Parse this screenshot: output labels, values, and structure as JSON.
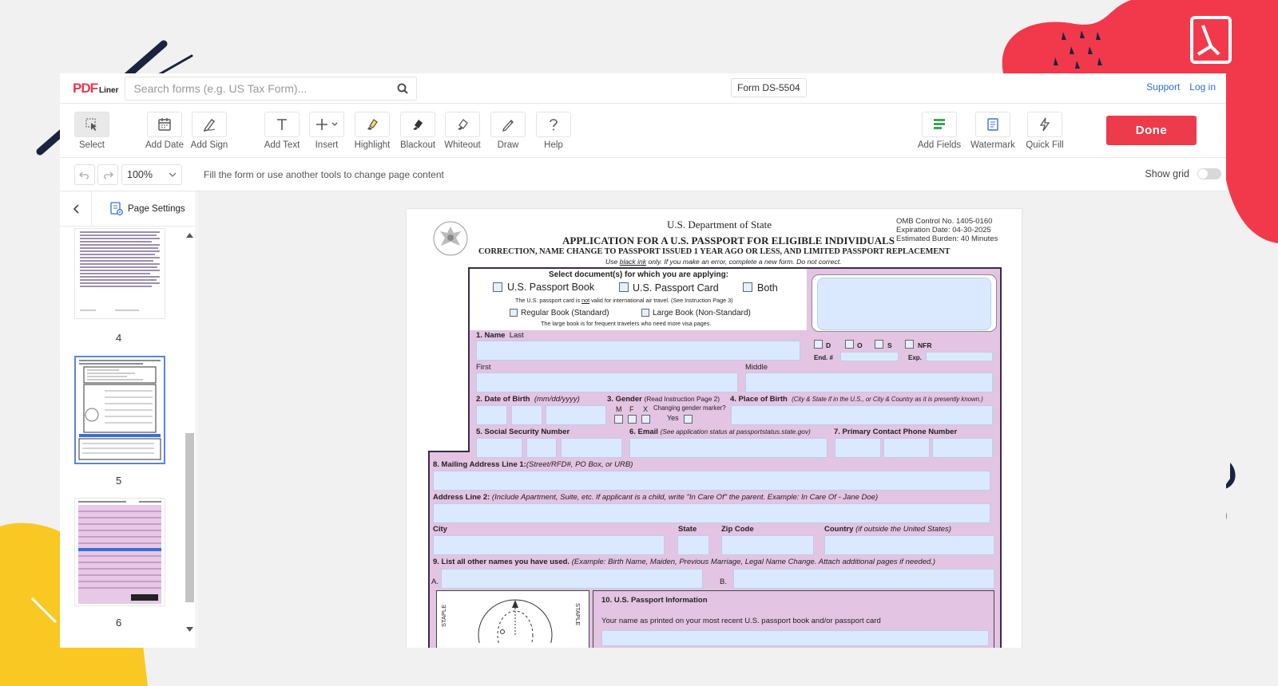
{
  "colors": {
    "accent": "#ed3b4b",
    "link": "#2a6fd6",
    "field": "#dbe9ff",
    "form_bg": "#e3c4e3"
  },
  "logo": {
    "main": "PDF",
    "sub": "Liner"
  },
  "search": {
    "placeholder": "Search forms (e.g. US Tax Form)...",
    "icon": "search-icon"
  },
  "form_name": "Form DS-5504",
  "links": {
    "support": "Support",
    "login": "Log in"
  },
  "toolbar": {
    "left": [
      {
        "label": "Select",
        "icon": "cursor-icon"
      },
      {
        "label": "Add Date",
        "icon": "calendar-icon"
      },
      {
        "label": "Add Sign",
        "icon": "signature-icon"
      },
      {
        "label": "Add Text",
        "icon": "text-icon"
      },
      {
        "label": "Insert",
        "icon": "plus-icon"
      },
      {
        "label": "Highlight",
        "icon": "highlighter-icon"
      },
      {
        "label": "Blackout",
        "icon": "blackout-icon"
      },
      {
        "label": "Whiteout",
        "icon": "eraser-icon"
      },
      {
        "label": "Draw",
        "icon": "pen-icon"
      },
      {
        "label": "Help",
        "icon": "help-icon"
      }
    ],
    "right": [
      {
        "label": "Add Fields",
        "icon": "fields-icon"
      },
      {
        "label": "Watermark",
        "icon": "watermark-icon"
      },
      {
        "label": "Quick Fill",
        "icon": "lightning-icon"
      }
    ],
    "done": "Done"
  },
  "subbar": {
    "zoom": "100%",
    "hint": "Fill the form or use another tools to change page content",
    "grid_label": "Show grid",
    "grid_on": false
  },
  "sidebar": {
    "page_settings": "Page Settings",
    "pages": [
      "4",
      "5",
      "6"
    ],
    "selected_page": "5"
  },
  "form": {
    "dept": "U.S. Department of State",
    "title": "APPLICATION FOR A U.S. PASSPORT FOR ELIGIBLE INDIVIDUALS",
    "subtitle": "CORRECTION, NAME CHANGE TO PASSPORT ISSUED 1 YEAR AGO OR LESS, AND LIMITED PASSPORT REPLACEMENT",
    "ink_note_pre": "Use ",
    "ink_note_u": "black ink",
    "ink_note_post": " only. If you make an error, complete a new form. Do not correct.",
    "omb": "OMB Control No. 1405-0160",
    "expiration": "Expiration Date: 04-30-2025",
    "burden": "Estimated Burden: 40 Minutes",
    "select_docs": "Select document(s) for which you are applying:",
    "book": "U.S. Passport Book",
    "card": "U.S. Passport Card",
    "both": "Both",
    "card_note_pre": "The U.S. passport card is ",
    "card_note_not": "not",
    "card_note_post": " valid for international air travel.  (See Instruction Page 3)",
    "regular_book": "Regular Book (Standard)",
    "large_book": "Large Book (Non-Standard)",
    "large_note": "The large book is for frequent travelers who need more visa pages.",
    "d": "D",
    "o": "O",
    "s": "S",
    "nfr": "NFR",
    "end": "End. #",
    "exp": "Exp.",
    "name": "1.  Name",
    "last": "Last",
    "first": "First",
    "middle": "Middle",
    "dob": "2.  Date of Birth",
    "dob_fmt": "(mm/dd/yyyy)",
    "gender": "3. Gender",
    "gender_note": "(Read Instruction Page 2)",
    "m": "M",
    "f": "F",
    "x": "X",
    "changing": "Changing gender marker?",
    "yes": "Yes",
    "pob": "4.  Place of Birth",
    "pob_note": "(City & State if in the U.S., or City & Country as it is presently known.)",
    "ssn": "5.  Social Security Number",
    "email": "6. Email",
    "email_note": "(See application status at passportstatus.state.gov)",
    "phone": "7. Primary Contact Phone Number",
    "mail": "8. Mailing Address Line 1:",
    "mail_note": "(Street/RFD#, PO Box, or URB)",
    "addr2": "Address Line 2:",
    "addr2_note": "(Include Apartment, Suite, etc. If applicant is a child, write \"In Care Of\" the parent. Example: In Care Of - Jane Doe)",
    "city": "City",
    "state": "State",
    "zip": "Zip Code",
    "country": "Country",
    "country_note": "(if outside the United States)",
    "other_names": "9. List all other names you have used.",
    "other_names_note": "(Example: Birth Name, Maiden, Previous Marriage, Legal Name Change.  Attach additional  pages if needed.)",
    "a": "A.",
    "b": "B.",
    "staple": "STAPLE",
    "passport_info": "10. U.S. Passport Information",
    "name_printed": "Your name as printed on your most recent U.S. passport book and/or passport card"
  }
}
